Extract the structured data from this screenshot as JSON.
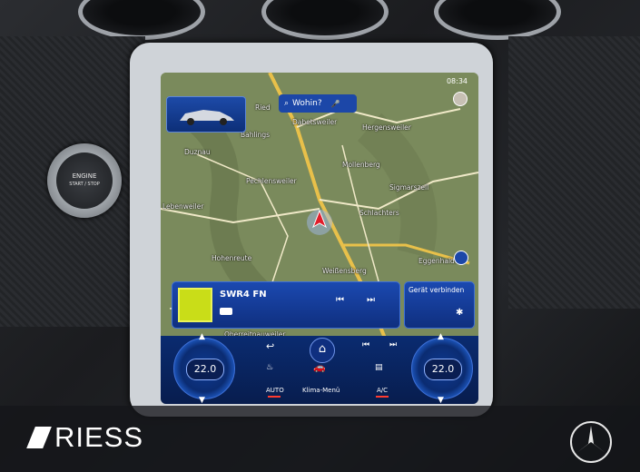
{
  "dashboard": {
    "start_button": {
      "line1": "ENGINE",
      "line2": "START / STOP"
    }
  },
  "nav": {
    "search_label": "Wohin?",
    "clock": "08:34",
    "places": [
      "Ried",
      "Dabetsweiler",
      "Hergensweiler",
      "Bahlings",
      "Duznau",
      "Pechlensweiler",
      "Mollenberg",
      "Sigmarszell",
      "Schlachters",
      "Hohenreute",
      "Weißensberg",
      "Eggenhalden",
      "Oberreitnau",
      "Lebenweiler",
      "Oberreitnauweiler"
    ]
  },
  "media": {
    "station": "SWR4 FN",
    "phone_card_label": "Gerät verbinden"
  },
  "climate": {
    "left_temp": "22.0",
    "right_temp": "22.0",
    "auto_label": "AUTO",
    "menu_label": "Klima-Menü",
    "ac_label": "A/C"
  },
  "footer": {
    "brand": "RIESS"
  },
  "colors": {
    "accent_blue": "#1c47a8",
    "station_art": "#c9dd18",
    "indicator_red": "#ff3b30"
  }
}
